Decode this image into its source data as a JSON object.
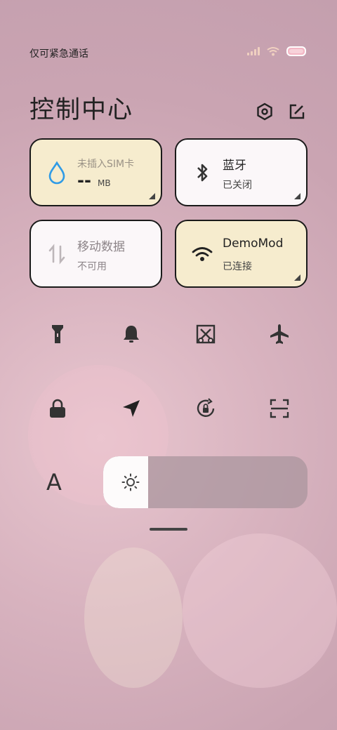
{
  "status_bar": {
    "carrier": "仅可紧急通话"
  },
  "header": {
    "title": "控制中心"
  },
  "tiles": [
    {
      "name": "mobile-data-usage",
      "title": "未插入SIM卡",
      "value": "--",
      "unit": "MB"
    },
    {
      "name": "bluetooth",
      "title": "蓝牙",
      "status": "已关闭"
    },
    {
      "name": "mobile-data",
      "title": "移动数据",
      "status": "不可用"
    },
    {
      "name": "wifi",
      "title": "DemoMod",
      "status": "已连接"
    }
  ],
  "quick_icons": [
    "flashlight-icon",
    "bell-icon",
    "screenshot-icon",
    "airplane-icon",
    "lock-icon",
    "location-icon",
    "rotation-lock-icon",
    "scan-icon"
  ],
  "font_button": {
    "label": "A"
  },
  "brightness": {
    "level": 0.22
  },
  "colors": {
    "tile_active": "#f6ecce",
    "tile_inactive": "#fbf7f9",
    "accent_blue": "#2f9be6"
  }
}
